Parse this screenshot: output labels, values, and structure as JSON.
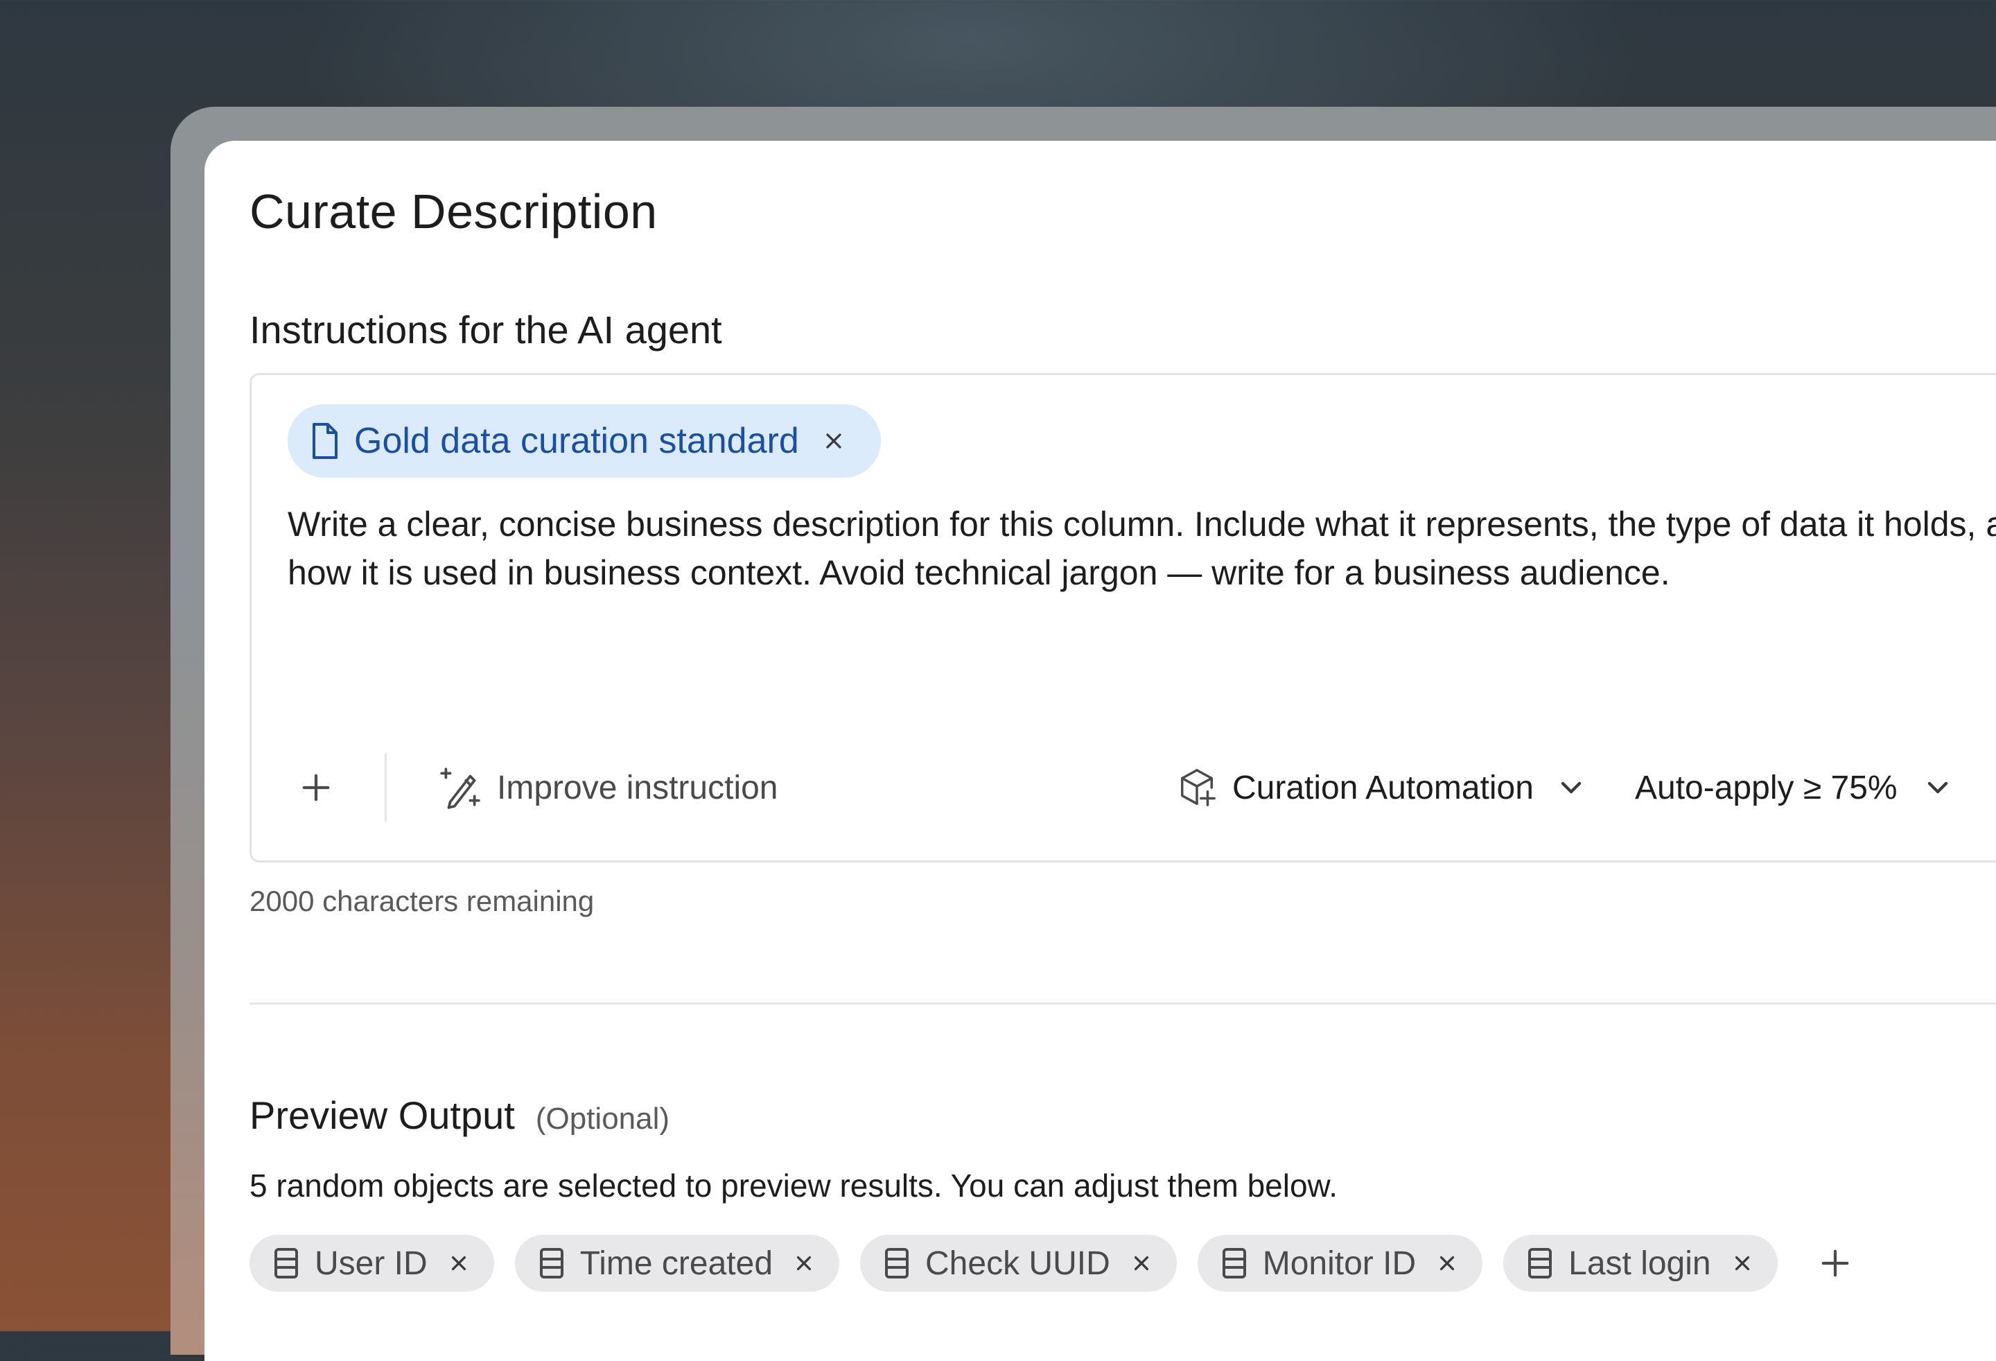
{
  "dialog": {
    "title": "Curate Description",
    "instructions_label": "Instructions for the AI agent"
  },
  "editor": {
    "attached_doc": {
      "label": "Gold data curation standard",
      "icon": "document-icon"
    },
    "instruction_text": "Write a clear, concise business description for this column. Include what it represents, the type of data it holds, and how it is used in business context. Avoid technical jargon — write for a business audience.",
    "toolbar": {
      "add_icon": "plus-icon",
      "improve_label": "Improve instruction",
      "improve_icon": "magic-wand-icon",
      "automation_label": "Curation Automation",
      "automation_icon": "cube-sparkle-icon",
      "autoapply_label": "Auto-apply ≥ 75%"
    },
    "char_remaining": "2000 characters remaining"
  },
  "preview": {
    "title": "Preview Output",
    "optional": "(Optional)",
    "description": "5 random objects are selected to preview results. You can adjust them below.",
    "objects": [
      {
        "label": "User ID"
      },
      {
        "label": "Time created"
      },
      {
        "label": "Check UUID"
      },
      {
        "label": "Monitor ID"
      },
      {
        "label": "Last login"
      }
    ]
  },
  "colors": {
    "doc_chip_bg": "#dcebfb",
    "doc_chip_text": "#1a4fa8",
    "object_chip_bg": "#e8e8ea"
  }
}
